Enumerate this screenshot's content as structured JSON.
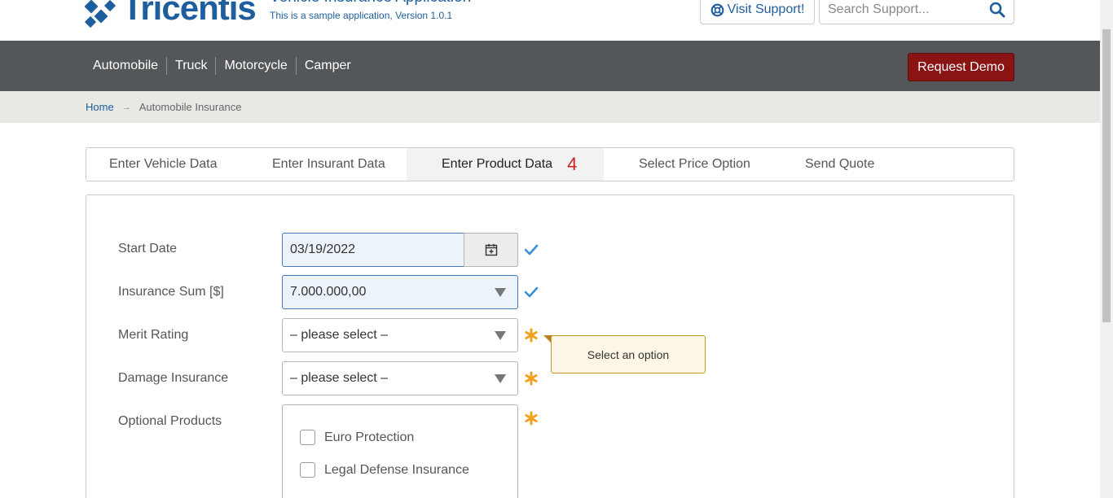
{
  "header": {
    "logo_text": "Tricentis",
    "app_title": "Vehicle Insurance Application",
    "app_subtitle": "This is a sample application, Version 1.0.1",
    "support_label": "Visit Support!",
    "search_placeholder": "Search Support...",
    "icons": {
      "support": "lifebuoy-icon",
      "search": "search-icon"
    }
  },
  "nav": {
    "items": [
      "Automobile",
      "Truck",
      "Motorcycle",
      "Camper"
    ],
    "demo_label": "Request Demo"
  },
  "breadcrumb": {
    "home": "Home",
    "separator": "→",
    "current": "Automobile Insurance"
  },
  "wizard": {
    "tabs": [
      {
        "label": "Enter Vehicle Data"
      },
      {
        "label": "Enter Insurant Data"
      },
      {
        "label": "Enter Product Data",
        "count": "4"
      },
      {
        "label": "Select Price Option"
      },
      {
        "label": "Send Quote"
      }
    ],
    "active_index": 2
  },
  "form": {
    "start_date": {
      "label": "Start Date",
      "value": "03/19/2022",
      "status": "valid"
    },
    "insurance_sum": {
      "label": "Insurance Sum [$]",
      "value": "7.000.000,00",
      "status": "valid"
    },
    "merit_rating": {
      "label": "Merit Rating",
      "value": "– please select –",
      "status": "required"
    },
    "damage_insurance": {
      "label": "Damage Insurance",
      "value": "– please select –",
      "status": "required"
    },
    "optional_products": {
      "label": "Optional Products",
      "status": "required",
      "options": [
        {
          "label": "Euro Protection",
          "checked": false
        },
        {
          "label": "Legal Defense Insurance",
          "checked": false
        }
      ]
    }
  },
  "tooltip": {
    "text": "Select an option"
  },
  "colors": {
    "brand": "#1f5e9e",
    "navbar": "#54575a",
    "demo_button": "#8a1313",
    "valid_check": "#3a8fd6",
    "required_star": "#f2a01f",
    "wizard_count": "#c91f1f"
  }
}
